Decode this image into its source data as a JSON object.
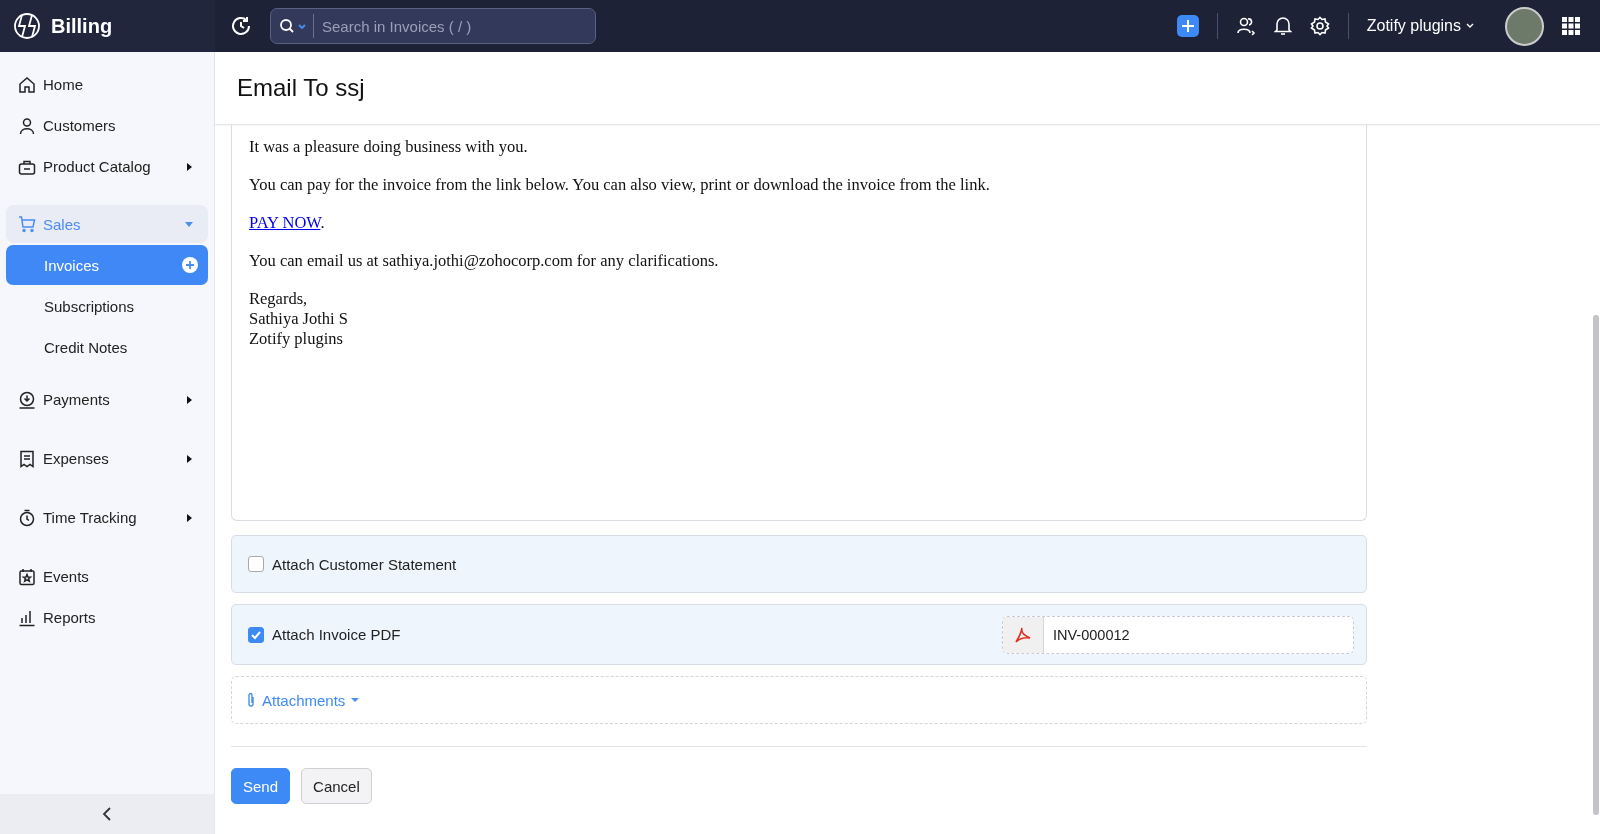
{
  "app": {
    "name": "Billing"
  },
  "search": {
    "placeholder": "Search in Invoices ( / )"
  },
  "org": {
    "name": "Zotify plugins"
  },
  "sidebar": {
    "items": [
      {
        "label": "Home"
      },
      {
        "label": "Customers"
      },
      {
        "label": "Product Catalog",
        "expanded": false
      },
      {
        "label": "Sales",
        "expanded": true,
        "children": [
          {
            "label": "Invoices",
            "selected": true
          },
          {
            "label": "Subscriptions",
            "selected": false
          },
          {
            "label": "Credit Notes",
            "selected": false
          }
        ]
      },
      {
        "label": "Payments",
        "expanded": false
      },
      {
        "label": "Expenses",
        "expanded": false
      },
      {
        "label": "Time Tracking",
        "expanded": false
      },
      {
        "label": "Events"
      },
      {
        "label": "Reports"
      }
    ]
  },
  "page": {
    "title": "Email To ssj"
  },
  "email_body": [
    {
      "kind": "text",
      "lines": [
        "It was a pleasure doing business with you."
      ]
    },
    {
      "kind": "text",
      "lines": [
        "You can pay for the invoice from the link below. You can also view, print or download the invoice from the link."
      ]
    },
    {
      "kind": "link",
      "link": "PAY NOW",
      "after": "."
    },
    {
      "kind": "text",
      "lines": [
        "You can email us at sathiya.jothi@zohocorp.com for any clarifications."
      ]
    },
    {
      "kind": "text",
      "lines": [
        "Regards,",
        "Sathiya Jothi S",
        "Zotify plugins"
      ]
    }
  ],
  "attach_options": [
    {
      "label": "Attach Customer Statement",
      "checked": false
    },
    {
      "label": "Attach Invoice PDF",
      "checked": true,
      "file": "INV-000012"
    }
  ],
  "attachments": {
    "label": "Attachments"
  },
  "buttons": [
    {
      "label": "Send",
      "kind": "primary"
    },
    {
      "label": "Cancel",
      "kind": "secondary"
    }
  ]
}
